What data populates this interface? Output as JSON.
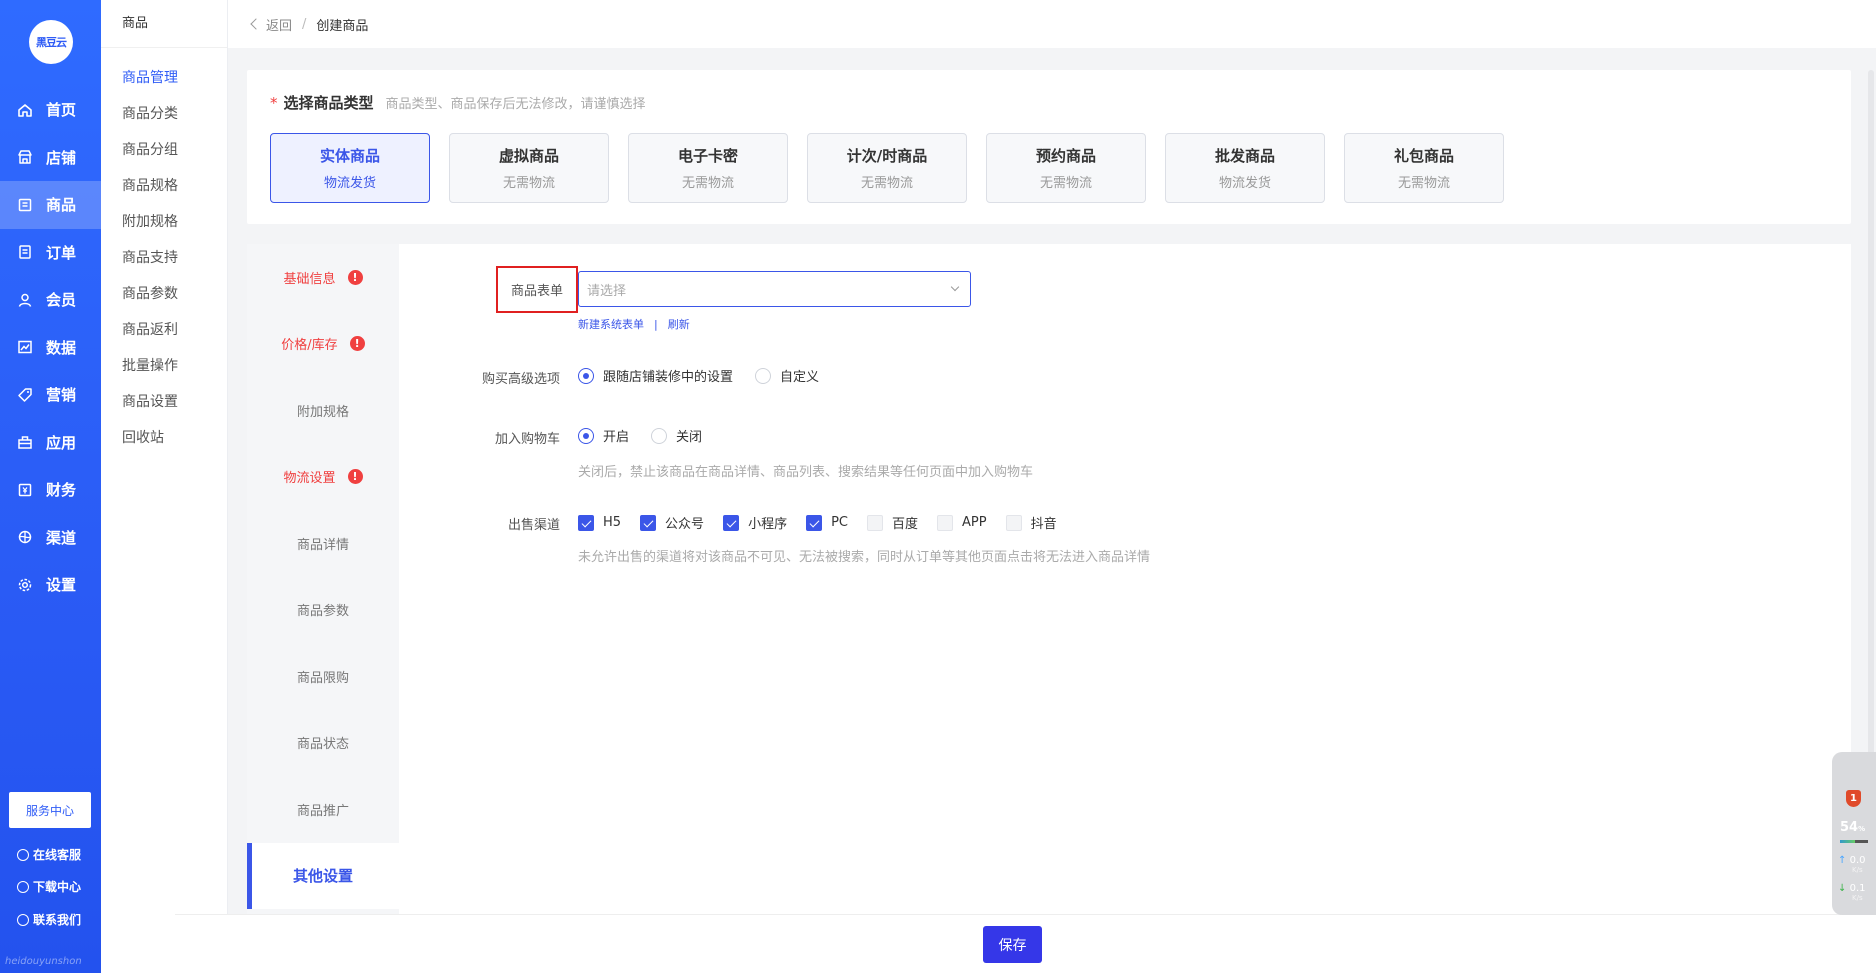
{
  "brand": {
    "logo_text": "黑豆云",
    "footer_text": "heidouyunshon"
  },
  "rail": {
    "items": [
      {
        "label": "首页",
        "icon": "home-icon"
      },
      {
        "label": "店铺",
        "icon": "store-icon"
      },
      {
        "label": "商品",
        "icon": "goods-icon",
        "active": true
      },
      {
        "label": "订单",
        "icon": "order-icon"
      },
      {
        "label": "会员",
        "icon": "user-icon"
      },
      {
        "label": "数据",
        "icon": "chart-icon"
      },
      {
        "label": "营销",
        "icon": "tag-icon"
      },
      {
        "label": "应用",
        "icon": "app-icon"
      },
      {
        "label": "财务",
        "icon": "finance-icon"
      },
      {
        "label": "渠道",
        "icon": "channel-icon"
      },
      {
        "label": "设置",
        "icon": "gear-icon"
      }
    ],
    "service_center": "服务中心",
    "links": [
      "在线客服",
      "下载中心",
      "联系我们"
    ]
  },
  "submenu": {
    "title": "商品",
    "items": [
      "商品管理",
      "商品分类",
      "商品分组",
      "商品规格",
      "附加规格",
      "商品支持",
      "商品参数",
      "商品返利",
      "批量操作",
      "商品设置",
      "回收站"
    ]
  },
  "breadcrumb": {
    "back": "返回",
    "separator": "/",
    "current": "创建商品"
  },
  "product_type": {
    "required_mark": "*",
    "title": "选择商品类型",
    "hint": "商品类型、商品保存后无法修改，请谨慎选择",
    "options": [
      {
        "name": "实体商品",
        "sub": "物流发货"
      },
      {
        "name": "虚拟商品",
        "sub": "无需物流"
      },
      {
        "name": "电子卡密",
        "sub": "无需物流"
      },
      {
        "name": "计次/时商品",
        "sub": "无需物流"
      },
      {
        "name": "预约商品",
        "sub": "无需物流"
      },
      {
        "name": "批发商品",
        "sub": "物流发货"
      },
      {
        "name": "礼包商品",
        "sub": "无需物流"
      }
    ]
  },
  "tabs": [
    {
      "label": "基础信息",
      "error": true
    },
    {
      "label": "价格/库存",
      "error": true
    },
    {
      "label": "附加规格",
      "error": false
    },
    {
      "label": "物流设置",
      "error": true
    },
    {
      "label": "商品详情",
      "error": false
    },
    {
      "label": "商品参数",
      "error": false
    },
    {
      "label": "商品限购",
      "error": false
    },
    {
      "label": "商品状态",
      "error": false
    },
    {
      "label": "商品推广",
      "error": false
    },
    {
      "label": "其他设置",
      "error": false,
      "active": true
    }
  ],
  "error_mark": "!",
  "form": {
    "product_form": {
      "label": "商品表单",
      "placeholder": "请选择",
      "link_new": "新建系统表单",
      "link_sep": "|",
      "link_refresh": "刷新"
    },
    "advanced_buy": {
      "label": "购买高级选项",
      "options": [
        "跟随店铺装修中的设置",
        "自定义"
      ],
      "selected": 0
    },
    "add_cart": {
      "label": "加入购物车",
      "options": [
        "开启",
        "关闭"
      ],
      "selected": 0,
      "help": "关闭后，禁止该商品在商品详情、商品列表、搜索结果等任何页面中加入购物车"
    },
    "channels": {
      "label": "出售渠道",
      "options": [
        {
          "label": "H5",
          "checked": true
        },
        {
          "label": "公众号",
          "checked": true
        },
        {
          "label": "小程序",
          "checked": true
        },
        {
          "label": "PC",
          "checked": true
        },
        {
          "label": "百度",
          "checked": false
        },
        {
          "label": "APP",
          "checked": false
        },
        {
          "label": "抖音",
          "checked": false
        }
      ],
      "help": "未允许出售的渠道将对该商品不可见、无法被搜索，同时从订单等其他页面点击将无法进入商品详情"
    }
  },
  "save_label": "保存",
  "widget": {
    "badge": "1",
    "percent": "54",
    "percent_unit": "%",
    "progress": 0.54,
    "up": "0.0",
    "down": "0.1",
    "unit": "K/s"
  },
  "colors": {
    "primary": "#3b56e8",
    "rail": "#2f6bff",
    "error": "#f04040",
    "save": "#3537e8"
  }
}
